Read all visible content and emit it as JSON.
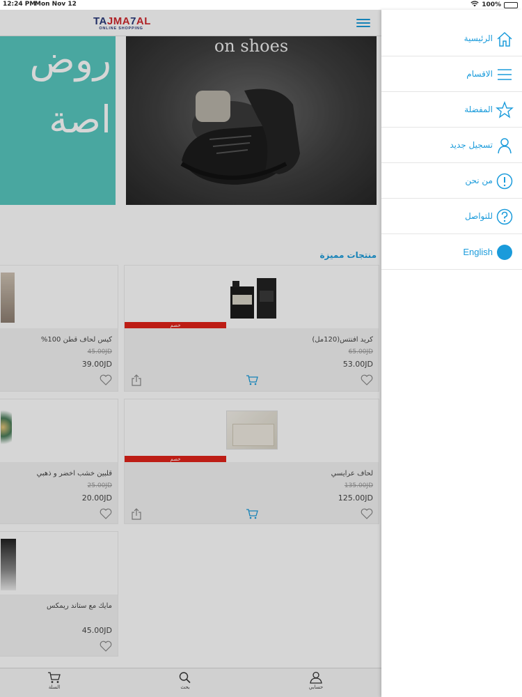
{
  "status_bar": {
    "time": "12:24 PM",
    "date": "Mon Nov 12",
    "battery": "100%"
  },
  "header": {
    "logo_main_a": "TA",
    "logo_main_b": "JMA",
    "logo_main_c": "7",
    "logo_main_d": "AL",
    "logo_sub": "ONLINE SHOPPING"
  },
  "banners": {
    "left_line1": "روض",
    "left_line2": "اصة",
    "right_headline": "on shoes"
  },
  "section": {
    "title": "منتجات مميزة"
  },
  "products": [
    {
      "name": "كريد افنتس(120مل)",
      "old_price": "65.00JD",
      "price": "53.00JD",
      "badge": "خصم"
    },
    {
      "name": "كيس لحاف قطن 100%",
      "old_price": "45.00JD",
      "price": "39.00JD"
    },
    {
      "name": "لحاف عرايسي",
      "old_price": "135.00JD",
      "price": "125.00JD",
      "badge": "خصم"
    },
    {
      "name": "قلبين خشب اخضر و ذهبي",
      "old_price": "25.00JD",
      "price": "20.00JD"
    },
    {
      "name": "مايك مع ستاند ريمكس",
      "old_price": "",
      "price": "45.00JD"
    }
  ],
  "tabbar": {
    "cart": "السلة",
    "search": "بحث",
    "account": "حسابي"
  },
  "menu": {
    "items": [
      {
        "label": "الرئيسية",
        "icon": "home-icon"
      },
      {
        "label": "الاقسام",
        "icon": "list-icon"
      },
      {
        "label": "المفضلة",
        "icon": "star-icon"
      },
      {
        "label": "تسجيل جديد",
        "icon": "user-icon"
      },
      {
        "label": "من نحن",
        "icon": "info-icon"
      },
      {
        "label": "للتواصل",
        "icon": "question-icon"
      },
      {
        "label": "English",
        "icon": "language-dot-icon"
      }
    ]
  },
  "colors": {
    "accent": "#1a9bdb",
    "discount": "#e2231a",
    "banner_teal": "#58c7bf"
  }
}
